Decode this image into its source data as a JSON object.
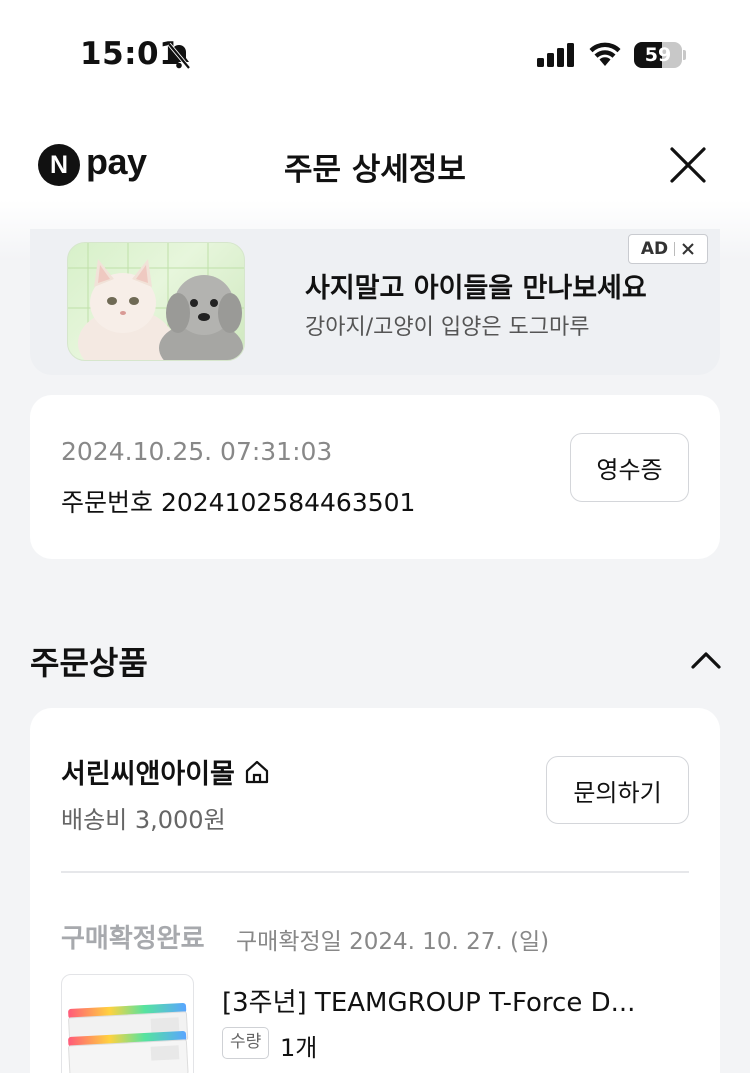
{
  "status_bar": {
    "time": "15:01",
    "battery": "59",
    "battery_level": 0.59
  },
  "header": {
    "logo_n": "N",
    "logo_pay": "pay",
    "title": "주문 상세정보"
  },
  "ad": {
    "title": "사지말고 아이들을 만나보세요",
    "subtitle": "강아지/고양이 입양은 도그마루",
    "badge": "AD"
  },
  "order": {
    "date": "2024.10.25. 07:31:03",
    "number": "주문번호 2024102584463501",
    "receipt_label": "영수증"
  },
  "section": {
    "title": "주문상품"
  },
  "product": {
    "store_name": "서린씨앤아이몰",
    "shipping": "배송비 3,000원",
    "inquiry_label": "문의하기",
    "status": "구매확정완료",
    "confirm_date": "구매확정일 2024. 10. 27. (일)",
    "name": "[3주년] TEAMGROUP T-Force D...",
    "qty_label": "수량",
    "qty_value": "1개"
  },
  "colors": {
    "background": "#f3f4f6",
    "card": "#ffffff",
    "muted_text": "#888888",
    "status_gray": "#a7a9ad"
  }
}
